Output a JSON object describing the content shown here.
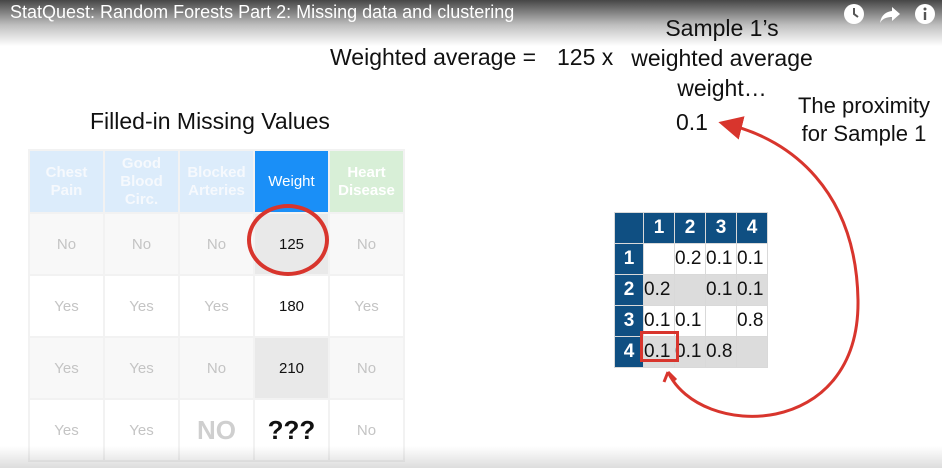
{
  "video": {
    "title": "StatQuest: Random Forests Part 2: Missing data and clustering",
    "icons": [
      "watch-later-icon",
      "share-icon",
      "info-icon"
    ]
  },
  "formula": {
    "lhs": "Weighted average =",
    "multiplier": "125 x",
    "rhs_lines": [
      "Sample 1’s",
      "weighted average",
      "weight…"
    ],
    "proximity_value": "0.1",
    "proximity_label_lines": [
      "The proximity",
      "for Sample 1"
    ]
  },
  "missing_table": {
    "title": "Filled-in Missing Values",
    "headers": [
      {
        "lines": [
          "Chest",
          "Pain"
        ]
      },
      {
        "lines": [
          "Good",
          "Blood",
          "Circ."
        ]
      },
      {
        "lines": [
          "Blocked",
          "Arteries"
        ]
      },
      {
        "lines": [
          "Weight"
        ]
      },
      {
        "lines": [
          "Heart",
          "Disease"
        ]
      }
    ],
    "rows": [
      [
        "No",
        "No",
        "No",
        "125",
        "No"
      ],
      [
        "Yes",
        "Yes",
        "Yes",
        "180",
        "Yes"
      ],
      [
        "Yes",
        "Yes",
        "No",
        "210",
        "No"
      ],
      [
        "Yes",
        "Yes",
        "NO",
        "???",
        "No"
      ]
    ]
  },
  "proximity_matrix": {
    "col_headers": [
      "1",
      "2",
      "3",
      "4"
    ],
    "row_headers": [
      "1",
      "2",
      "3",
      "4"
    ],
    "cells": [
      [
        "",
        "0.2",
        "0.1",
        "0.1"
      ],
      [
        "0.2",
        "",
        "0.1",
        "0.1"
      ],
      [
        "0.1",
        "0.1",
        "",
        "0.8"
      ],
      [
        "0.1",
        "0.1",
        "0.8",
        ""
      ]
    ]
  },
  "colors": {
    "accent_red": "#d8352d",
    "weight_header_blue": "#1a8ff7",
    "matrix_header_navy": "#0f4f82",
    "heart_header_green": "#d8efd7",
    "faded_header_blue": "#dcecfb"
  }
}
